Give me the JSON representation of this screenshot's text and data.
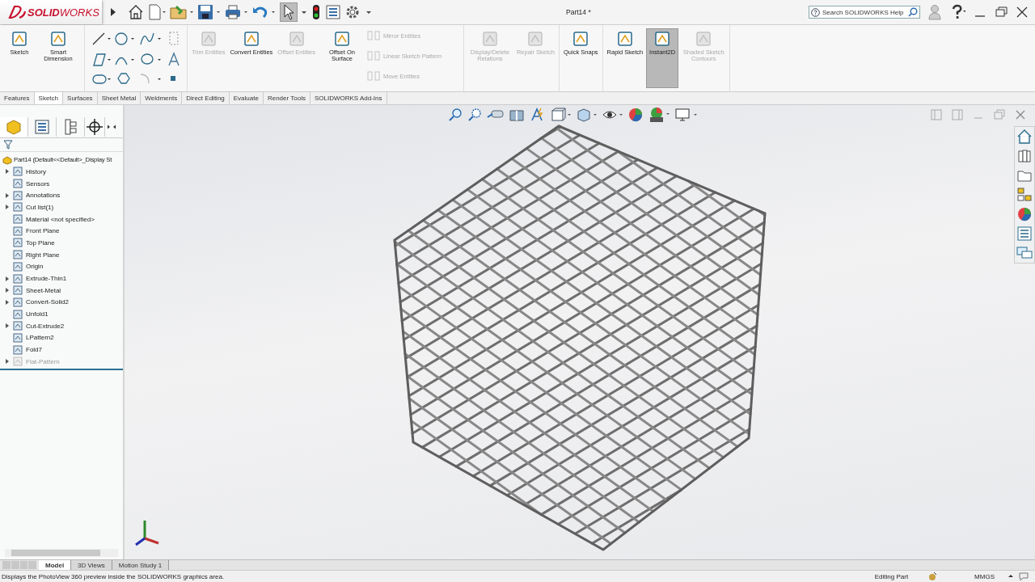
{
  "window": {
    "logo": "**SOLID**WORKS",
    "title": "Part14 *"
  },
  "search": {
    "placeholder": "Search SOLIDWORKS Help"
  },
  "ribbon": {
    "groups": [
      {
        "commands": [
          {
            "kind": "large",
            "label": "Sketch",
            "disabled": false,
            "selected": false
          },
          {
            "kind": "large",
            "label": "Smart Dimension",
            "disabled": false,
            "selected": false
          }
        ]
      },
      {
        "commands": [
          {
            "kind": "tools"
          }
        ]
      },
      {
        "commands": [
          {
            "kind": "large",
            "label": "Trim Entities",
            "disabled": true,
            "selected": false
          },
          {
            "kind": "large",
            "label": "Convert Entities",
            "disabled": false,
            "selected": false
          },
          {
            "kind": "large",
            "label": "Offset Entities",
            "disabled": true,
            "selected": false
          },
          {
            "kind": "large",
            "label": "Offset On Surface",
            "disabled": false,
            "selected": false
          },
          {
            "kind": "row",
            "label": "Mirror Entities",
            "disabled": true
          },
          {
            "kind": "row",
            "label": "Linear Sketch Pattern",
            "disabled": true
          },
          {
            "kind": "row",
            "label": "Move Entities",
            "disabled": true
          }
        ]
      },
      {
        "commands": [
          {
            "kind": "large",
            "label": "Display/Delete Relations",
            "disabled": true,
            "selected": false
          },
          {
            "kind": "large",
            "label": "Repair Sketch",
            "disabled": true,
            "selected": false
          }
        ]
      },
      {
        "commands": [
          {
            "kind": "large",
            "label": "Quick Snaps",
            "disabled": false,
            "selected": false
          }
        ]
      },
      {
        "commands": [
          {
            "kind": "large",
            "label": "Rapid Sketch",
            "disabled": false,
            "selected": false
          },
          {
            "kind": "large",
            "label": "Instant2D",
            "disabled": false,
            "selected": true
          },
          {
            "kind": "large",
            "label": "Shaded Sketch Contours",
            "disabled": true,
            "selected": false
          }
        ]
      }
    ]
  },
  "command_tabs": [
    {
      "label": "Features",
      "selected": false
    },
    {
      "label": "Sketch",
      "selected": true
    },
    {
      "label": "Surfaces",
      "selected": false
    },
    {
      "label": "Sheet Metal",
      "selected": false
    },
    {
      "label": "Weldments",
      "selected": false
    },
    {
      "label": "Direct Editing",
      "selected": false
    },
    {
      "label": "Evaluate",
      "selected": false
    },
    {
      "label": "Render Tools",
      "selected": false
    },
    {
      "label": "SOLIDWORKS Add-Ins",
      "selected": false
    }
  ],
  "feature_tree": {
    "root": {
      "label": "Part14  (Default<<Default>_Display St",
      "children": [
        {
          "label": "History",
          "expandable": true,
          "disabled": false
        },
        {
          "label": "Sensors",
          "expandable": false,
          "disabled": false
        },
        {
          "label": "Annotations",
          "expandable": true,
          "disabled": false
        },
        {
          "label": "Cut list(1)",
          "expandable": true,
          "disabled": false
        },
        {
          "label": "Material <not specified>",
          "expandable": false,
          "disabled": false
        },
        {
          "label": "Front Plane",
          "expandable": false,
          "disabled": false
        },
        {
          "label": "Top Plane",
          "expandable": false,
          "disabled": false
        },
        {
          "label": "Right Plane",
          "expandable": false,
          "disabled": false
        },
        {
          "label": "Origin",
          "expandable": false,
          "disabled": false
        },
        {
          "label": "Extrude-Thin1",
          "expandable": true,
          "disabled": false
        },
        {
          "label": "Sheet-Metal",
          "expandable": true,
          "disabled": false
        },
        {
          "label": "Convert-Solid2",
          "expandable": true,
          "disabled": false
        },
        {
          "label": "Unfold1",
          "expandable": false,
          "disabled": false
        },
        {
          "label": "Cut-Extrude2",
          "expandable": true,
          "disabled": false
        },
        {
          "label": "LPattern2",
          "expandable": false,
          "disabled": false
        },
        {
          "label": "Fold7",
          "expandable": false,
          "disabled": false
        },
        {
          "label": "Flat-Pattern",
          "expandable": true,
          "disabled": true
        }
      ]
    }
  },
  "bottom_tabs": [
    {
      "label": "Model",
      "selected": true
    },
    {
      "label": "3D Views",
      "selected": false
    },
    {
      "label": "Motion Study 1",
      "selected": false
    }
  ],
  "status_bar": {
    "message": "Displays the PhotoView 360 preview inside the SOLIDWORKS graphics area.",
    "mode": "Editing Part",
    "units": "MMGS"
  }
}
